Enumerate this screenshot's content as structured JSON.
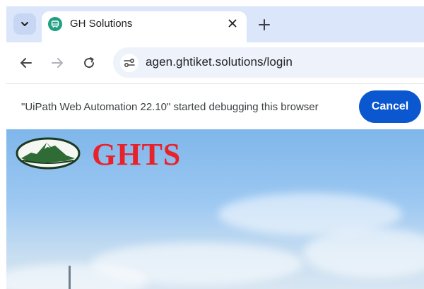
{
  "browser": {
    "tab": {
      "title": "GH Solutions"
    },
    "address_bar": {
      "url": "agen.ghtiket.solutions/login"
    }
  },
  "infobar": {
    "message": "\"UiPath Web Automation 22.10\" started debugging this browser",
    "cancel_label": "Cancel"
  },
  "page": {
    "brand_text": "GHTS"
  },
  "icons": {
    "tab_search": "chevron-down-icon",
    "favicon": "ghts-favicon-icon",
    "tab_close": "close-icon",
    "new_tab": "plus-icon",
    "back": "arrow-left-icon",
    "forward": "arrow-right-icon",
    "reload": "reload-icon",
    "site_info": "tune-icon"
  },
  "colors": {
    "tabbar_bg": "#dbe6fb",
    "cancel_button": "#0b57d0",
    "brand_red": "#e8222b",
    "sky": "#9cc8f2"
  }
}
